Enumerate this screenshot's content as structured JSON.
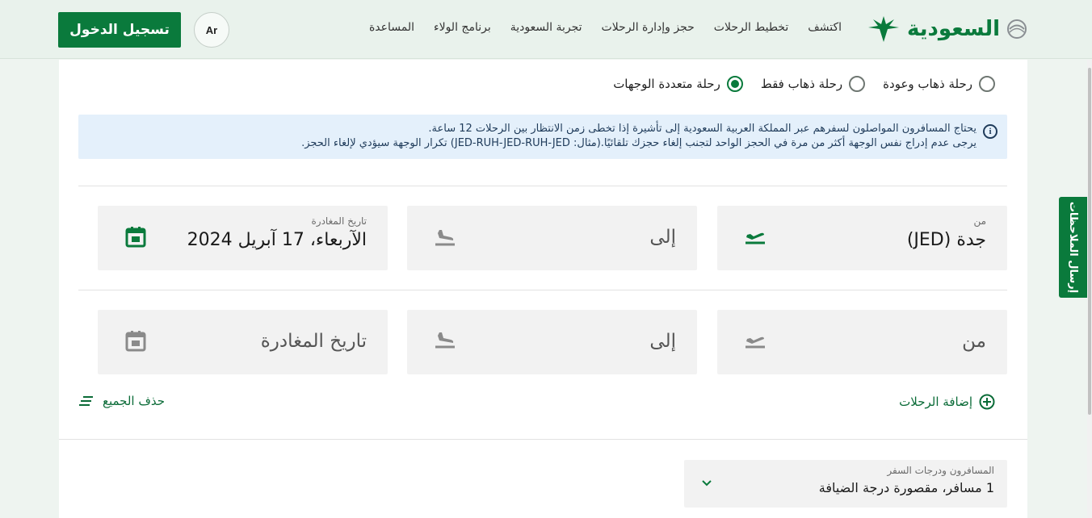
{
  "header": {
    "logo_text": "السعودية",
    "nav": [
      "اكتشف",
      "تخطيط الرحلات",
      "حجز وإدارة الرحلات",
      "تجربة السعودية",
      "برنامج الولاء",
      "المساعدة"
    ],
    "lang_label": "Ar",
    "login_label": "تسجيل الدخول"
  },
  "trip_types": [
    {
      "label": "رحلة ذهاب وعودة",
      "selected": false
    },
    {
      "label": "رحلة ذهاب فقط",
      "selected": false
    },
    {
      "label": "رحلة متعددة الوجهات",
      "selected": true
    }
  ],
  "info": {
    "line1": "يحتاج المسافرون المواصلون لسفرهم عبر المملكة العربية السعودية إلى تأشيرة إذا تخطى زمن الانتظار بين الرحلات 12 ساعة.",
    "line2": "يرجى عدم إدراج نفس الوجهة أكثر من مرة في الحجز الواحد لتجنب إلغاء حجزك تلقائيًا.(مثال: JED-RUH-JED-RUH-JED) تكرار الوجهة سيؤدي لإلغاء الحجز."
  },
  "segments": [
    {
      "from_label": "من",
      "from_value": "جدة (JED)",
      "to_placeholder": "إلى",
      "date_label": "تاريخ المغادرة",
      "date_value": "الآربعاء، 17 آبريل 2024"
    },
    {
      "from_placeholder": "من",
      "to_placeholder": "إلى",
      "date_placeholder": "تاريخ المغادرة"
    }
  ],
  "actions": {
    "add_flights": "إضافة الرحلات",
    "clear_all": "حذف الجميع"
  },
  "passengers": {
    "label": "المسافرون ودرجات السفر",
    "value": "1 مسافر، مقصورة درجة الضيافة"
  },
  "feedback_label": "إرسال الملاحظات",
  "colors": {
    "brand": "#0a7a3c",
    "info_bg": "#e4f0fb",
    "field_bg": "#f2f2f2"
  }
}
